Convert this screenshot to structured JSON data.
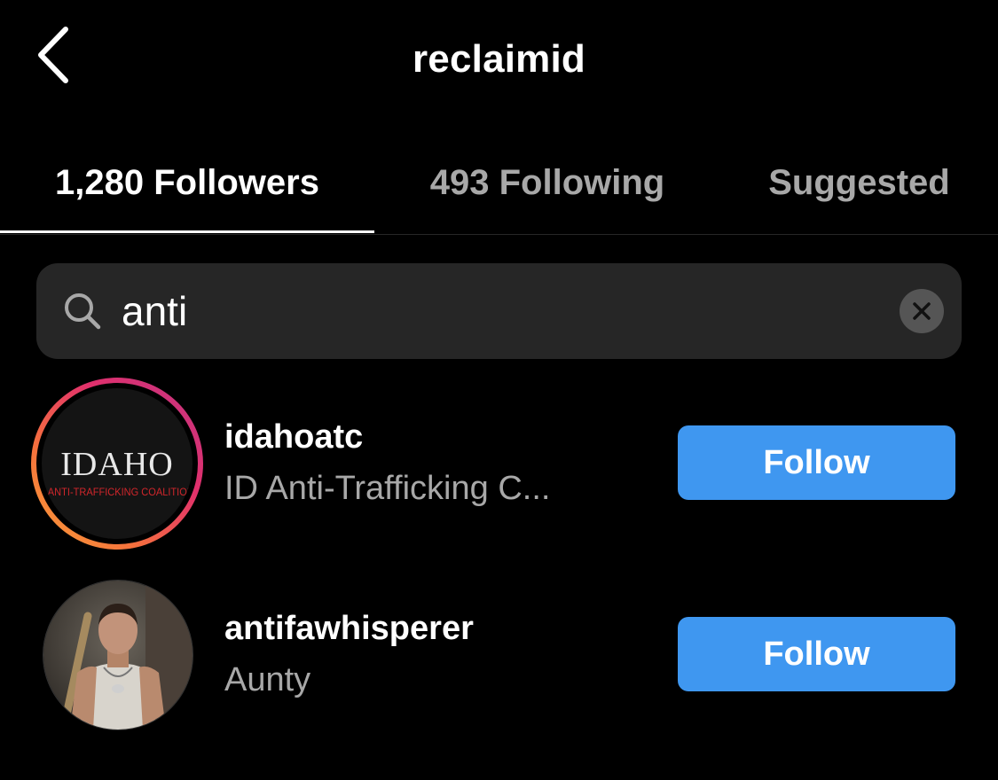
{
  "header": {
    "title": "reclaimid",
    "back_icon": "chevron-left-icon"
  },
  "tabs": [
    {
      "label": "1,280 Followers",
      "active": true
    },
    {
      "label": "493 Following",
      "active": false
    },
    {
      "label": "Suggested",
      "active": false
    }
  ],
  "search": {
    "value": "anti",
    "icon": "search-icon",
    "clear_icon": "clear-icon"
  },
  "results": [
    {
      "username": "idahoatc",
      "subtitle": "ID Anti-Trafficking C...",
      "follow_label": "Follow",
      "has_story_ring": true,
      "avatar_logo_title": "IDAHO",
      "avatar_logo_subtitle": "ANTI-TRAFFICKING COALITION"
    },
    {
      "username": "antifawhisperer",
      "subtitle": "Aunty",
      "follow_label": "Follow",
      "has_story_ring": false
    }
  ],
  "colors": {
    "background": "#000000",
    "follow_button": "#3f97f0",
    "secondary_text": "#a8a8a8",
    "search_bg": "#262626",
    "logo_red": "#d0262b"
  }
}
